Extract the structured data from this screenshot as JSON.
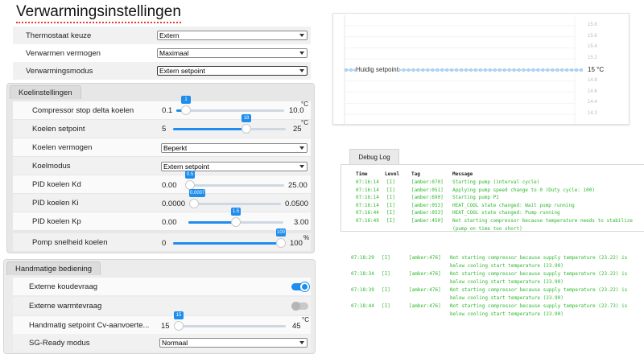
{
  "title": "Verwarmingsinstellingen",
  "heating": [
    {
      "label": "Thermostaat keuze",
      "value": "Extern"
    },
    {
      "label": "Verwarmen vermogen",
      "value": "Maximaal"
    },
    {
      "label": "Verwarmingsmodus",
      "value": "Extern setpoint"
    }
  ],
  "cooling": {
    "tab": "Koelinstellingen",
    "compressor": {
      "label": "Compressor stop delta koelen",
      "min": "0.1",
      "max": "10.0",
      "unit": "°C",
      "value": "1",
      "fraction": 0.09
    },
    "setpoint": {
      "label": "Koelen setpoint",
      "min": "5",
      "max": "25",
      "unit": "°C",
      "value": "18",
      "fraction": 0.65
    },
    "power": {
      "label": "Koelen vermogen",
      "value": "Beperkt"
    },
    "mode": {
      "label": "Koelmodus",
      "value": "Extern setpoint"
    },
    "kd": {
      "label": "PID koelen Kd",
      "min": "0.00",
      "max": "25.00",
      "value": "0.5",
      "fraction": 0.02
    },
    "ki": {
      "label": "PID koelen Ki",
      "min": "0.0000",
      "max": "0.0500",
      "value": "0.0007",
      "fraction": 0.04
    },
    "kp": {
      "label": "PID koelen Kp",
      "min": "0.00",
      "max": "3.00",
      "value": "1.5",
      "fraction": 0.5
    },
    "pump": {
      "label": "Pomp snelheid koelen",
      "min": "0",
      "max": "100",
      "unit": "%",
      "value": "100",
      "fraction": 1.0
    }
  },
  "manual": {
    "tab": "Handmatige bediening",
    "external_cold": {
      "label": "Externe koudevraag",
      "state": "on"
    },
    "external_heat": {
      "label": "Externe warmtevraag",
      "state": "off"
    },
    "setpoint": {
      "label": "Handmatig setpoint Cv-aanvoerte...",
      "min": "15",
      "max": "45",
      "unit": "°C",
      "value": "15",
      "fraction": 0.0
    },
    "sgready": {
      "label": "SG-Ready modus",
      "value": "Normaal"
    }
  },
  "chart": {
    "series_label": "Huidig setpoint",
    "value_label": "15 °C",
    "ticks": [
      "15.8",
      "15.6",
      "15.4",
      "15.2",
      "14.8",
      "14.6",
      "14.4",
      "14.2"
    ]
  },
  "chart_data": {
    "type": "line",
    "series": [
      {
        "name": "Huidig setpoint",
        "values": [
          15,
          15,
          15,
          15,
          15,
          15,
          15,
          15,
          15,
          15,
          15,
          15,
          15,
          15,
          15,
          15,
          15,
          15,
          15,
          15,
          15,
          15,
          15,
          15,
          15,
          15,
          15,
          15,
          15,
          15,
          15,
          15,
          15,
          15,
          15,
          15,
          15,
          15,
          15,
          15,
          15,
          15,
          15,
          15,
          15,
          15,
          15,
          15,
          15,
          15
        ]
      }
    ],
    "ylim": [
      14.1,
      15.9
    ],
    "yticks": [
      15.8,
      15.6,
      15.4,
      15.2,
      14.8,
      14.6,
      14.4,
      14.2
    ]
  },
  "debug": {
    "tab": "Debug Log",
    "headers": {
      "time": "Time",
      "level": "Level",
      "tag": "Tag",
      "message": "Message"
    },
    "top_entries": [
      {
        "time": "07:16:14",
        "level": "[I]",
        "tag": "[amber:070]",
        "message": "Starting pump (interval cycle)"
      },
      {
        "time": "07:16:14",
        "level": "[I]",
        "tag": "[amber:051]",
        "message": "Applying pump speed change to 0 (Duty cycle: 100)"
      },
      {
        "time": "07:16:14",
        "level": "[I]",
        "tag": "[amber:690]",
        "message": "Starting pump P1"
      },
      {
        "time": "07:16:14",
        "level": "[I]",
        "tag": "[amber:053]",
        "message": "HEAT_COOL state changed: Wait pump running"
      },
      {
        "time": "07:16:44",
        "level": "[I]",
        "tag": "[amber:053]",
        "message": "HEAT_COOL state changed: Pump running"
      },
      {
        "time": "07:16:49",
        "level": "[I]",
        "tag": "[amber:450]",
        "message": "Not starting compressor because temperature needs to stabilize",
        "cont": "(pump on time too short)"
      }
    ],
    "bottom_entries": [
      {
        "time": "07:18:29",
        "level": "[I]",
        "tag": "[amber:476]",
        "message": "Not starting compressor because supply temperature (23.22) is",
        "cont": "below cooling start temperature (23.90)"
      },
      {
        "time": "07:18:34",
        "level": "[I]",
        "tag": "[amber:476]",
        "message": "Not starting compressor because supply temperature (23.22) is",
        "cont": "below cooling start temperature (23.90)"
      },
      {
        "time": "07:18:39",
        "level": "[I]",
        "tag": "[amber:476]",
        "message": "Not starting compressor because supply temperature (23.22) is",
        "cont": "below cooling start temperature (23.90)"
      },
      {
        "time": "07:18:44",
        "level": "[I]",
        "tag": "[amber:476]",
        "message": "Not starting compressor because supply temperature (22.73) is",
        "cont": "below cooling start temperature (23.90)"
      }
    ]
  },
  "colors": {
    "accent": "#1f8ded",
    "log_green": "#2db82d",
    "title_underline": "#e23b3b"
  }
}
